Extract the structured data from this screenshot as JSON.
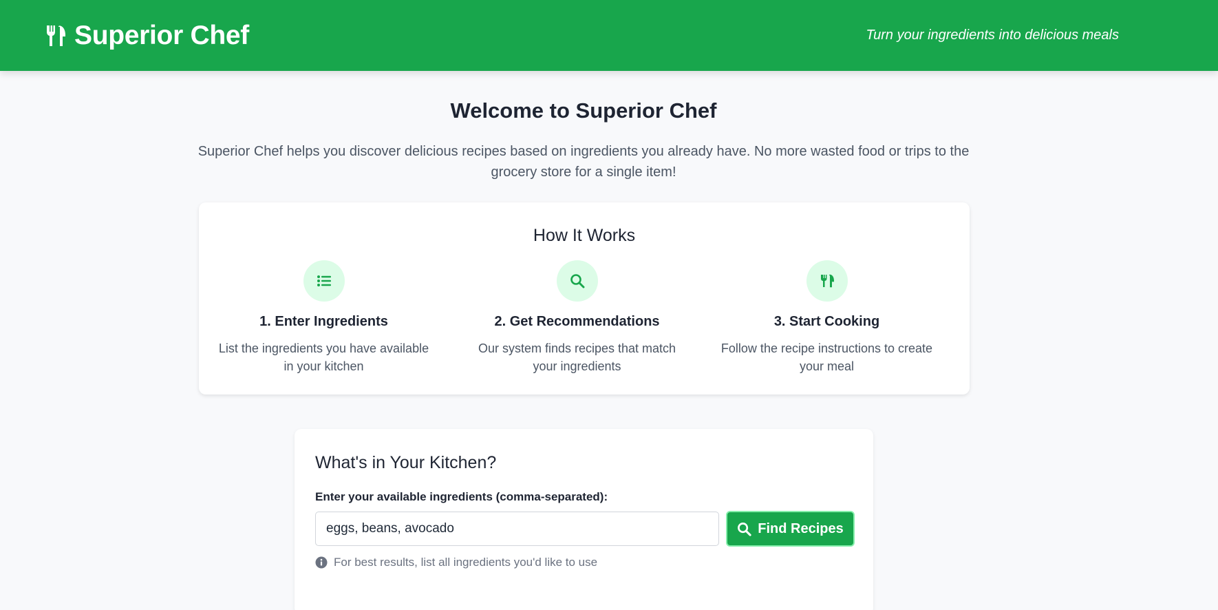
{
  "header": {
    "brand": "Superior Chef",
    "tagline": "Turn your ingredients into delicious meals",
    "brand_icon": "utensils-icon",
    "color": "#18a64c"
  },
  "welcome": {
    "title": "Welcome to Superior Chef",
    "text": "Superior Chef helps you discover delicious recipes based on ingredients you already have. No more wasted food or trips to the grocery store for a single item!"
  },
  "how_it_works": {
    "title": "How It Works",
    "steps": [
      {
        "icon": "list-icon",
        "title": "1. Enter Ingredients",
        "description": "List the ingredients you have available in your kitchen"
      },
      {
        "icon": "search-icon",
        "title": "2. Get Recommendations",
        "description": "Our system finds recipes that match your ingredients"
      },
      {
        "icon": "utensils-icon",
        "title": "3. Start Cooking",
        "description": "Follow the recipe instructions to create your meal"
      }
    ]
  },
  "kitchen": {
    "title": "What's in Your Kitchen?",
    "label": "Enter your available ingredients (comma-separated):",
    "input_value": "eggs, beans, avocado",
    "button_label": "Find Recipes",
    "hint": "For best results, list all ingredients you'd like to use"
  }
}
